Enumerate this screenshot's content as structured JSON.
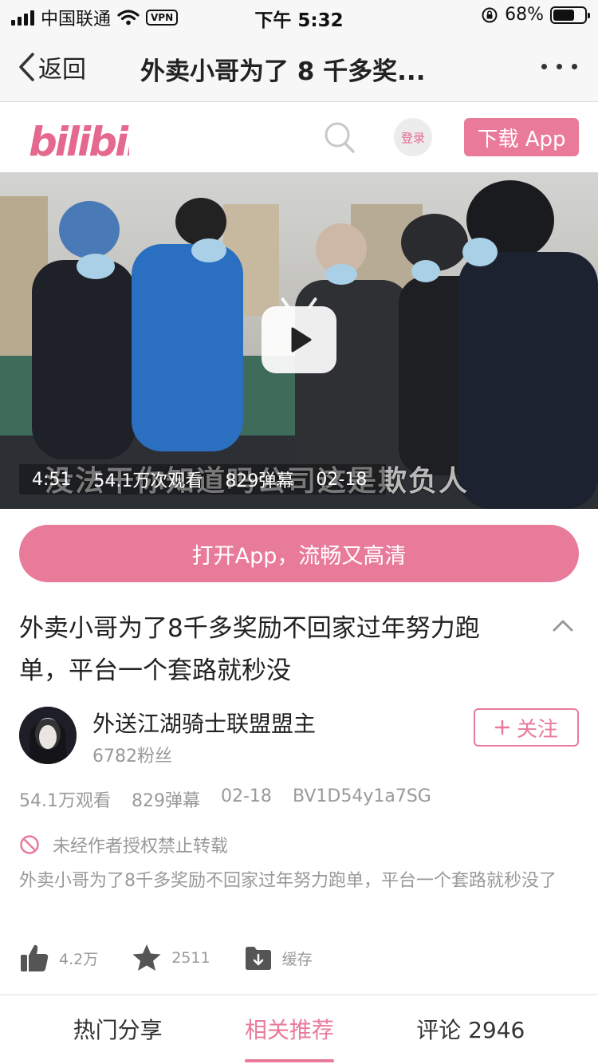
{
  "status_bar": {
    "carrier": "中国联通",
    "vpn": "VPN",
    "time": "下午 5:32",
    "battery": "68%",
    "battery_level": 0.68
  },
  "nav": {
    "back_label": "返回",
    "title": "外卖小哥为了 8 千多奖..."
  },
  "header": {
    "logo_text": "bilibili",
    "login_label": "登录",
    "download_label": "下载 App",
    "brand_color": "#ea7a9a"
  },
  "video": {
    "duration": "4:51",
    "views": "54.1万次观看",
    "danmaku": "829弹幕",
    "date": "02-18",
    "subtitle": "没法干你知道吗公司这是欺负人"
  },
  "open_app_label": "打开App，流畅又高清",
  "title": "外卖小哥为了8千多奖励不回家过年努力跑单，平台一个套路就秒没",
  "uploader": {
    "name": "外送江湖骑士联盟盟主",
    "fans": "6782粉丝",
    "follow_label": "关注"
  },
  "stats": {
    "views": "54.1万观看",
    "danmaku": "829弹幕",
    "date": "02-18",
    "bvid": "BV1D54y1a7SG"
  },
  "copyright_notice": "未经作者授权禁止转载",
  "description": "外卖小哥为了8千多奖励不回家过年努力跑单，平台一个套路就秒没了",
  "actions": {
    "like_count": "4.2万",
    "coin_count": "2511",
    "cache_label": "缓存"
  },
  "tabs": [
    {
      "label": "热门分享"
    },
    {
      "label": "相关推荐"
    },
    {
      "label": "评论 2946"
    }
  ],
  "active_tab": "相关推荐"
}
